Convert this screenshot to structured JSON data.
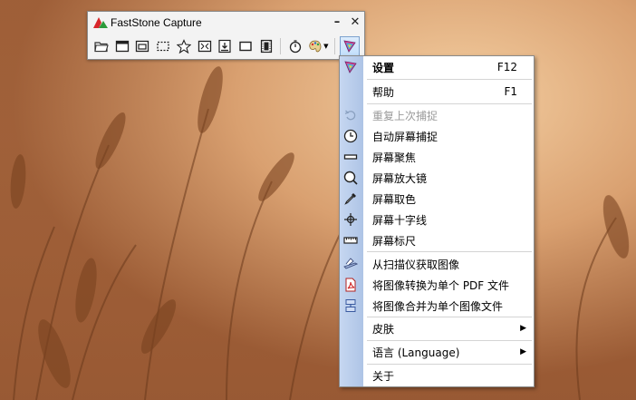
{
  "app": {
    "title": "FastStone Capture",
    "minimize_glyph": "–",
    "close_glyph": "✕"
  },
  "toolbar": {
    "buttons": [
      {
        "name": "open-file",
        "icon": "folder-icon"
      },
      {
        "name": "capture-window",
        "icon": "window-icon"
      },
      {
        "name": "capture-object",
        "icon": "object-window-icon"
      },
      {
        "name": "capture-rectangle",
        "icon": "rectangle-region-icon"
      },
      {
        "name": "capture-freehand",
        "icon": "freehand-region-icon"
      },
      {
        "name": "capture-fullscreen",
        "icon": "fullscreen-icon"
      },
      {
        "name": "capture-scrolling",
        "icon": "scrolling-window-icon"
      },
      {
        "name": "capture-fixed",
        "icon": "fixed-region-icon"
      },
      {
        "name": "screen-recorder",
        "icon": "film-icon"
      },
      {
        "name": "delay-timer",
        "icon": "timer-icon"
      },
      {
        "name": "output",
        "icon": "palette-icon"
      },
      {
        "name": "settings-menu",
        "icon": "settings-brush-icon"
      }
    ]
  },
  "menu": {
    "items": [
      {
        "label": "设置",
        "shortcut": "F12",
        "bold": true,
        "icon": "settings-brush-icon"
      },
      {
        "label": "帮助",
        "shortcut": "F1"
      },
      {
        "label": "重复上次捕捉",
        "disabled": true,
        "icon": "repeat-icon"
      },
      {
        "label": "自动屏幕捕捉",
        "icon": "clock-icon"
      },
      {
        "label": "屏幕聚焦",
        "icon": "focus-bar-icon"
      },
      {
        "label": "屏幕放大镜",
        "icon": "magnifier-icon"
      },
      {
        "label": "屏幕取色",
        "icon": "color-picker-icon"
      },
      {
        "label": "屏幕十字线",
        "icon": "crosshair-icon"
      },
      {
        "label": "屏幕标尺",
        "icon": "ruler-icon"
      },
      {
        "label": "从扫描仪获取图像",
        "icon": "scanner-icon"
      },
      {
        "label": "将图像转换为单个 PDF 文件",
        "icon": "pdf-icon"
      },
      {
        "label": "将图像合并为单个图像文件",
        "icon": "combine-images-icon"
      },
      {
        "label": "皮肤",
        "submenu": true
      },
      {
        "label": "语言 (Language)",
        "submenu": true
      },
      {
        "label": "关于"
      }
    ]
  },
  "colors": {
    "menu_strip": "#b8cdec",
    "disabled_text": "#9a9a9a",
    "logo_red": "#d8262b",
    "logo_green": "#2c9a3a"
  }
}
